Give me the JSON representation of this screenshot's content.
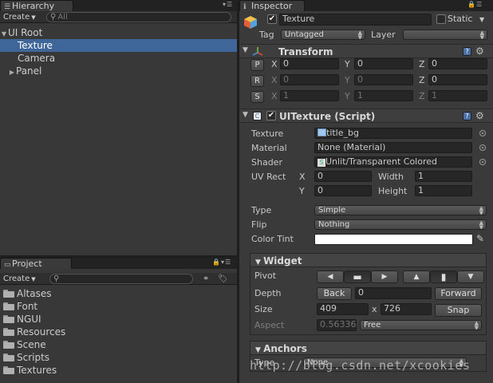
{
  "hierarchy": {
    "tab_label": "Hierarchy",
    "create_label": "Create",
    "search_placeholder": "All",
    "items": [
      {
        "label": "UI Root",
        "expanded": true
      },
      {
        "label": "Texture",
        "selected": true
      },
      {
        "label": "Camera"
      },
      {
        "label": "Panel",
        "collapsed": true
      }
    ]
  },
  "project": {
    "tab_label": "Project",
    "create_label": "Create",
    "folders": [
      "Altases",
      "Font",
      "NGUI",
      "Resources",
      "Scene",
      "Scripts",
      "Textures"
    ]
  },
  "inspector": {
    "tab_label": "Inspector",
    "object": {
      "active": true,
      "name": "Texture",
      "static_label": "Static",
      "static": false,
      "tag_label": "Tag",
      "tag_value": "Untagged",
      "layer_label": "Layer",
      "layer_value": ""
    },
    "transform": {
      "title": "Transform",
      "rows": [
        {
          "button": "P",
          "x": "0",
          "y": "0",
          "z": "0"
        },
        {
          "button": "R",
          "x": "0",
          "y": "0",
          "z": "0"
        },
        {
          "button": "S",
          "x": "1",
          "y": "1",
          "z": "1"
        }
      ],
      "axis_x": "X",
      "axis_y": "Y",
      "axis_z": "Z"
    },
    "uitexture": {
      "title": "UITexture (Script)",
      "enabled": true,
      "texture_label": "Texture",
      "texture_value": "title_bg",
      "material_label": "Material",
      "material_value": "None (Material)",
      "shader_label": "Shader",
      "shader_value": "Unlit/Transparent Colored",
      "uvrect_label": "UV Rect",
      "uv_x_label": "X",
      "uv_x": "0",
      "uv_y_label": "Y",
      "uv_y": "0",
      "width_label": "Width",
      "width": "1",
      "height_label": "Height",
      "height": "1",
      "type_label": "Type",
      "type_value": "Simple",
      "flip_label": "Flip",
      "flip_value": "Nothing",
      "tint_label": "Color Tint",
      "tint_color": "#ffffff"
    },
    "widget": {
      "title": "Widget",
      "pivot_label": "Pivot",
      "depth_label": "Depth",
      "back_label": "Back",
      "depth_value": "0",
      "forward_label": "Forward",
      "size_label": "Size",
      "size_w": "409",
      "size_x": "x",
      "size_h": "726",
      "snap_label": "Snap",
      "aspect_label": "Aspect",
      "aspect_value": "0.56336",
      "aspect_mode": "Free"
    },
    "anchors": {
      "title": "Anchors",
      "type_label": "Type",
      "type_value": "None"
    }
  },
  "watermark": "http://blog.csdn.net/xcookies",
  "colors": {
    "selection": "#3e6699",
    "panel_bg": "#383838",
    "field_bg": "#262626"
  }
}
